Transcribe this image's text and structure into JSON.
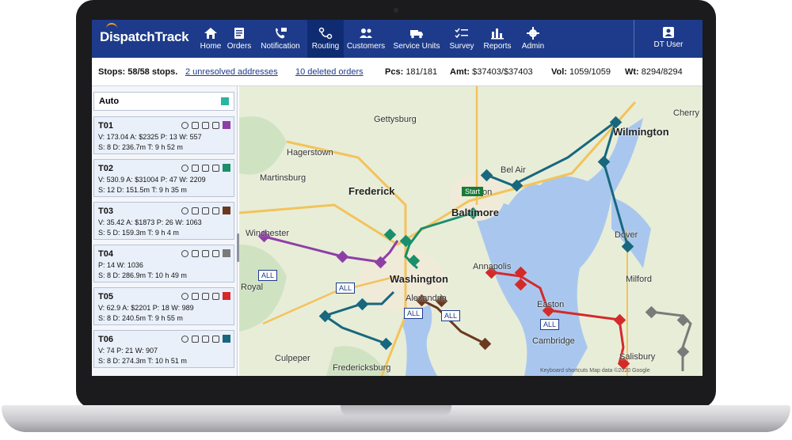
{
  "app": {
    "logo": "DispatchTrack"
  },
  "nav": {
    "items": [
      {
        "label": "Home",
        "icon": "home-icon"
      },
      {
        "label": "Orders",
        "icon": "orders-icon"
      },
      {
        "label": "Notification",
        "icon": "notification-icon"
      },
      {
        "label": "Routing",
        "icon": "routing-icon",
        "active": true
      },
      {
        "label": "Customers",
        "icon": "customers-icon"
      },
      {
        "label": "Service Units",
        "icon": "service-units-icon"
      },
      {
        "label": "Survey",
        "icon": "survey-icon"
      },
      {
        "label": "Reports",
        "icon": "reports-icon"
      },
      {
        "label": "Admin",
        "icon": "admin-icon"
      }
    ],
    "user": "DT User"
  },
  "stats": {
    "stops": "Stops: 58/58 stops.",
    "unresolved": "2 unresolved addresses",
    "deleted": "10 deleted orders",
    "pcs_label": "Pcs:",
    "pcs": "181/181",
    "amt_label": "Amt:",
    "amt": "$37403/$37403",
    "vol_label": "Vol:",
    "vol": "1059/1059",
    "wt_label": "Wt:",
    "wt": "8294/8294"
  },
  "sidebar": {
    "auto": {
      "label": "Auto",
      "color": "#2bb5a0"
    },
    "trucks": [
      {
        "name": "T01",
        "line1": "V: 173.04  A: $2325  P: 13  W: 557",
        "line2": "S: 8  D: 236.7m  T: 9 h 52 m",
        "color": "#8e3fa6"
      },
      {
        "name": "T02",
        "line1": "V: 530.9  A: $31004  P: 47  W: 2209",
        "line2": "S: 12  D: 151.5m  T: 9 h 35 m",
        "color": "#1a8f6a"
      },
      {
        "name": "T03",
        "line1": "V: 35.42  A: $1873  P: 26  W: 1063",
        "line2": "S: 5  D: 159.3m  T: 9 h 4 m",
        "color": "#6b3a1e"
      },
      {
        "name": "T04",
        "line1": "P: 14  W: 1036",
        "line2": "S: 8  D: 286.9m  T: 10 h 49 m",
        "color": "#7a7a7a"
      },
      {
        "name": "T05",
        "line1": "V: 62.9  A: $2201  P: 18  W: 989",
        "line2": "S: 8  D: 240.5m  T: 9 h 55 m",
        "color": "#d42a2a"
      },
      {
        "name": "T06",
        "line1": "V: 74  P: 21  W: 907",
        "line2": "S: 8  D: 274.3m  T: 10 h 51 m",
        "color": "#17677e"
      }
    ]
  },
  "map": {
    "cities": [
      "Gettysburg",
      "Hagerstown",
      "Frederick",
      "Martinsburg",
      "Winchester",
      "Baltimore",
      "Towson",
      "Bel Air",
      "Annapolis",
      "Washington",
      "Easton",
      "Cambridge",
      "Dover",
      "Milford",
      "Culpeper",
      "Fredericksburg",
      "Salisbury",
      "Wilmington",
      "Cherry",
      "Royal",
      "Alexandria"
    ],
    "start_label": "Start",
    "all_label": "ALL",
    "footer": "Keyboard shortcuts   Map data ©2020 Google"
  }
}
